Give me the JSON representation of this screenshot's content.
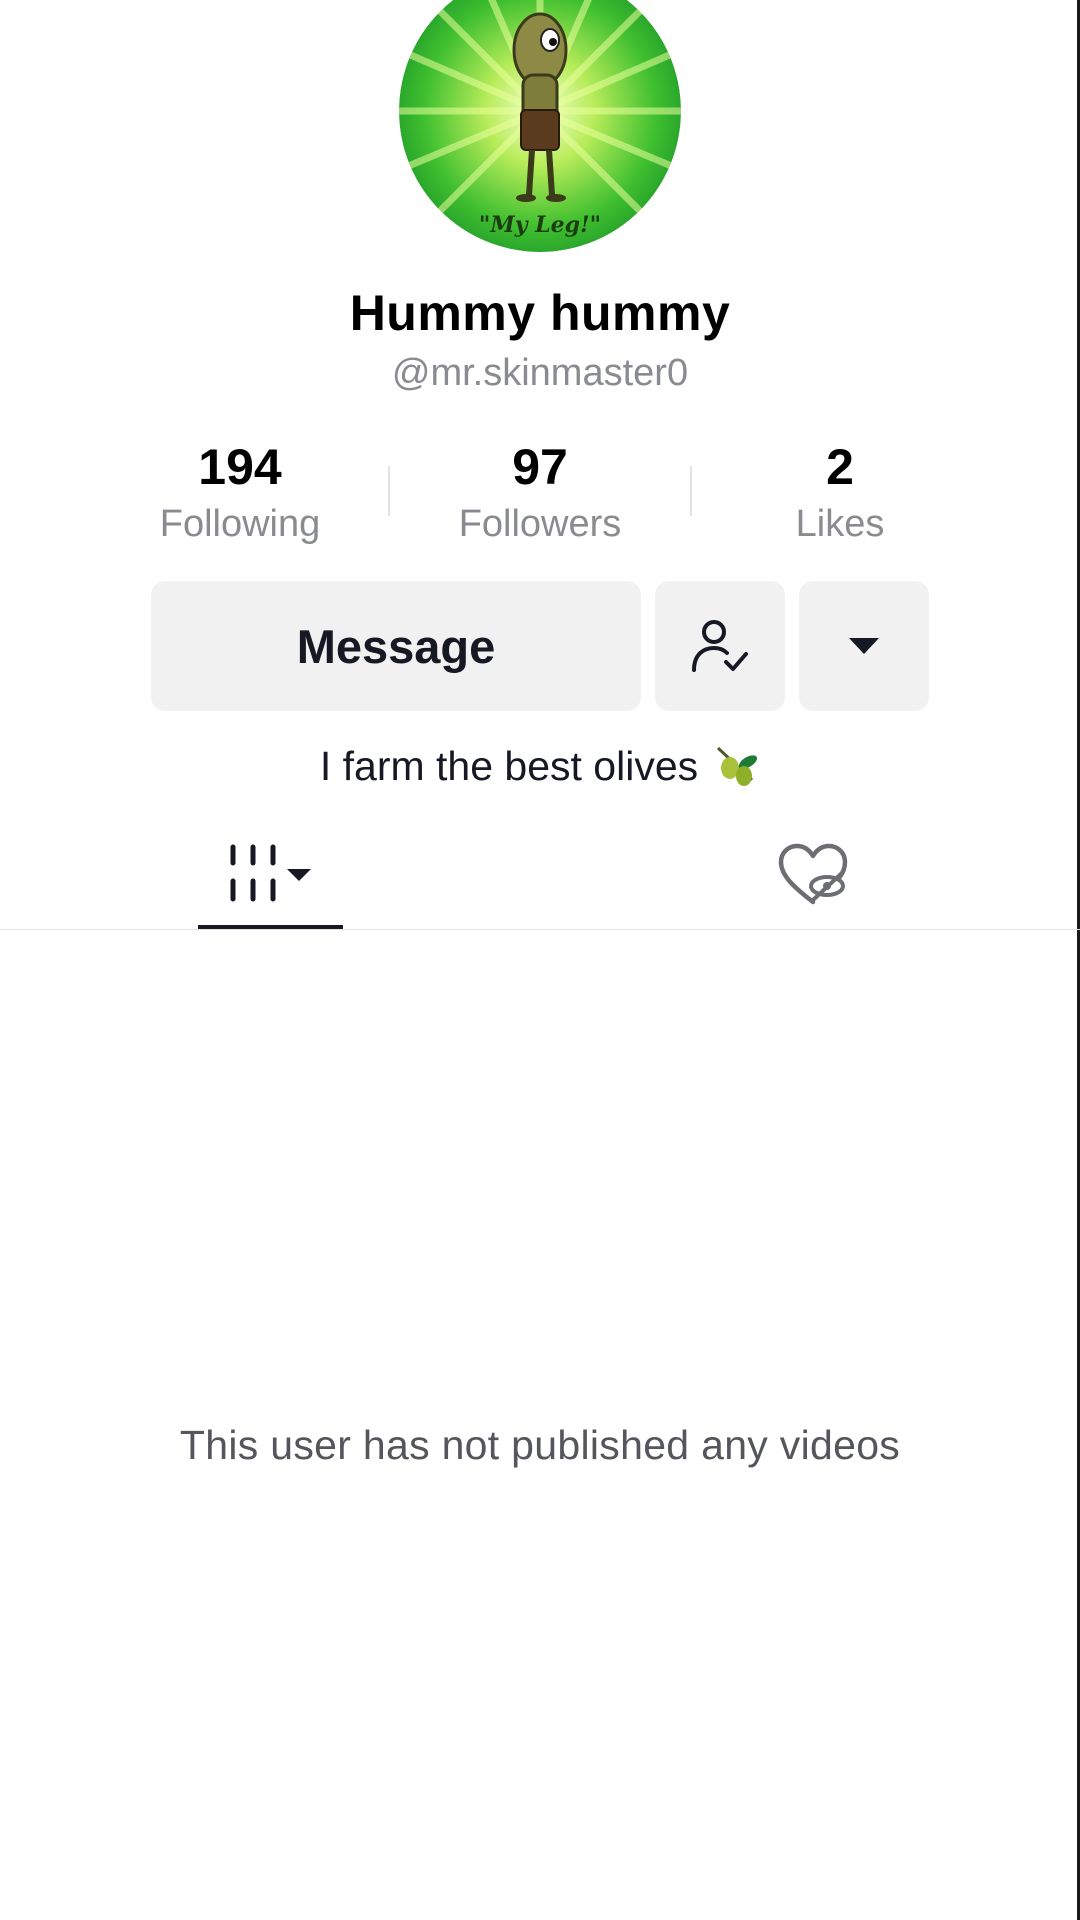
{
  "profile": {
    "avatar_caption": "\"My Leg!\"",
    "display_name": "Hummy hummy",
    "username": "@mr.skinmaster0",
    "bio": "I farm the best olives",
    "bio_emoji": "olive-emoji-icon"
  },
  "stats": [
    {
      "value": "194",
      "label": "Following"
    },
    {
      "value": "97",
      "label": "Followers"
    },
    {
      "value": "2",
      "label": "Likes"
    }
  ],
  "actions": {
    "message_label": "Message",
    "friend_icon": "person-check-icon",
    "more_icon": "caret-down-icon"
  },
  "tabs": [
    {
      "icon": "grid-videos-icon",
      "active": true
    },
    {
      "icon": "liked-hidden-icon",
      "active": false
    }
  ],
  "content": {
    "empty_message": "This user has not published any videos"
  },
  "colors": {
    "text_primary": "#161823",
    "text_secondary": "#8a8b91",
    "button_bg": "#f1f1f2",
    "divider": "#e3e3e4"
  }
}
